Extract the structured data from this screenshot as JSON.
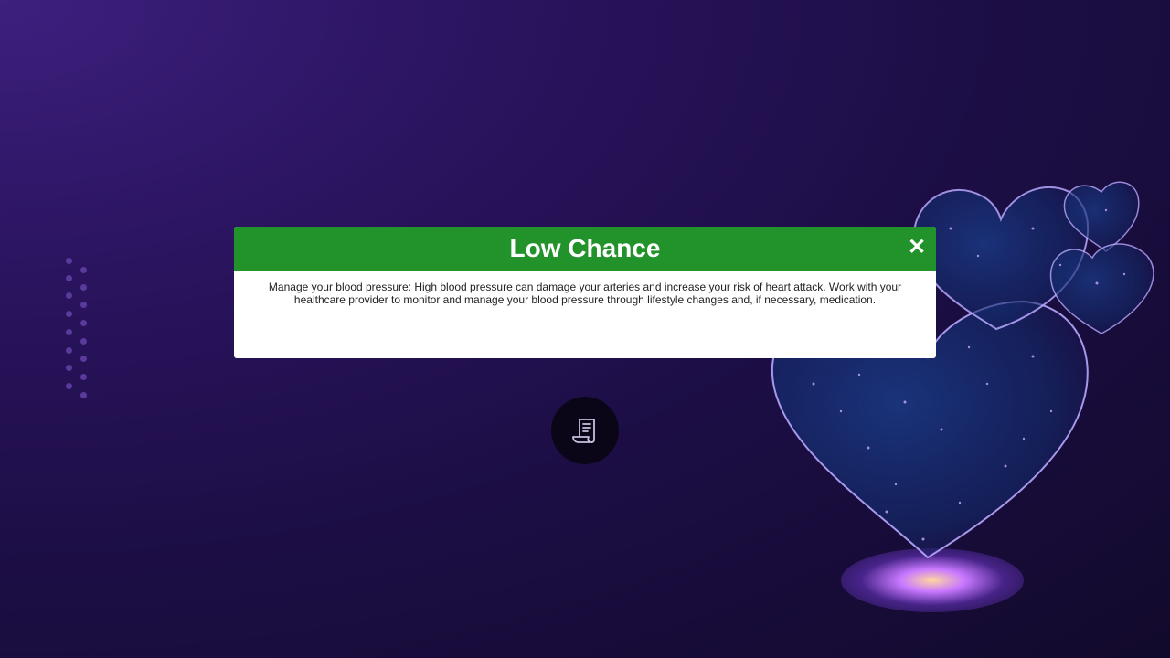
{
  "modal": {
    "title": "Low Chance",
    "close_symbol": "✕",
    "header_color": "#22932a",
    "body_text": "Manage your blood pressure: High blood pressure can damage your arteries and increase your risk of heart attack. Work with your healthcare provider to monitor and manage your blood pressure through lifestyle changes and, if necessary, medication."
  },
  "fab": {
    "icon": "receipt-icon"
  },
  "background": {
    "decoration": "hearts-illustration"
  }
}
